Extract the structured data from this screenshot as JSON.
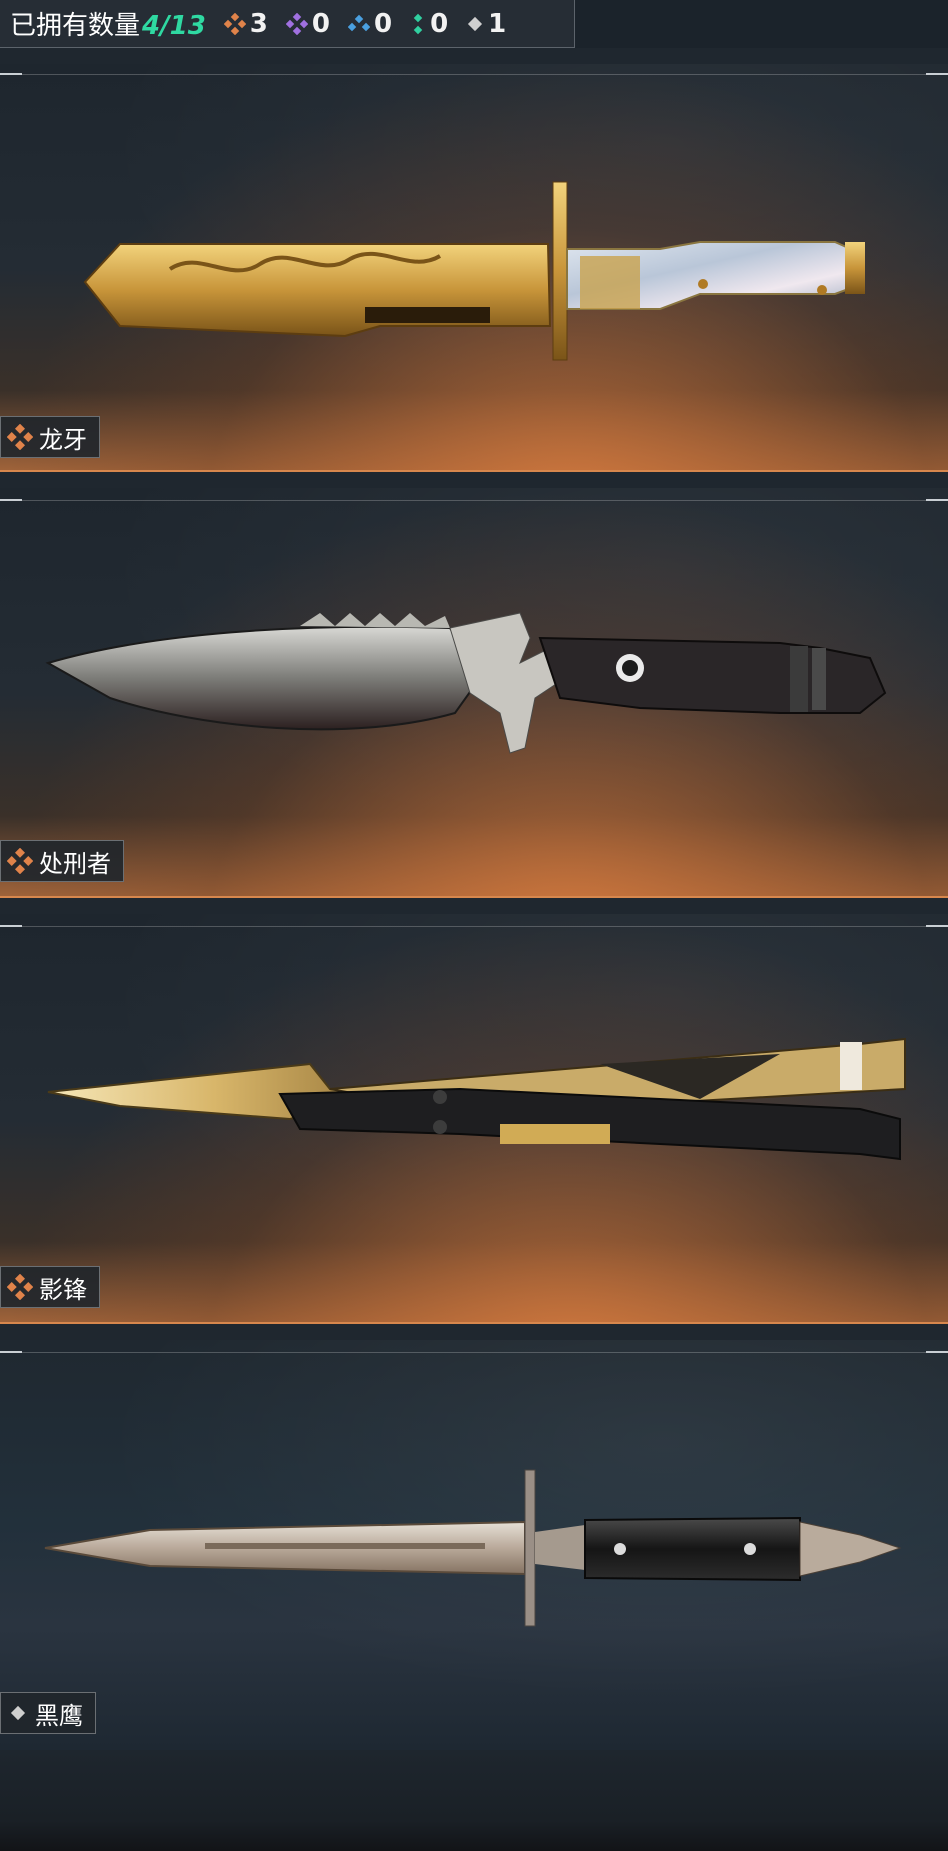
{
  "header": {
    "owned_label": "已拥有数量",
    "owned_count": "4/13",
    "rarity_counts": [
      {
        "icon": "orange-diamond-icon",
        "value": "3",
        "color": "#e0834a"
      },
      {
        "icon": "purple-diamond-icon",
        "value": "0",
        "color": "#a070e0"
      },
      {
        "icon": "blue-diamond-icon",
        "value": "0",
        "color": "#4aa0e0"
      },
      {
        "icon": "green-diamond-icon",
        "value": "0",
        "color": "#30d0a0"
      },
      {
        "icon": "gray-diamond-icon",
        "value": "1",
        "color": "#cfcfcf"
      }
    ]
  },
  "items": [
    {
      "name": "龙牙",
      "rarity": "orange"
    },
    {
      "name": "处刑者",
      "rarity": "orange"
    },
    {
      "name": "影锋",
      "rarity": "orange"
    },
    {
      "name": "黑鹰",
      "rarity": "gray"
    }
  ]
}
